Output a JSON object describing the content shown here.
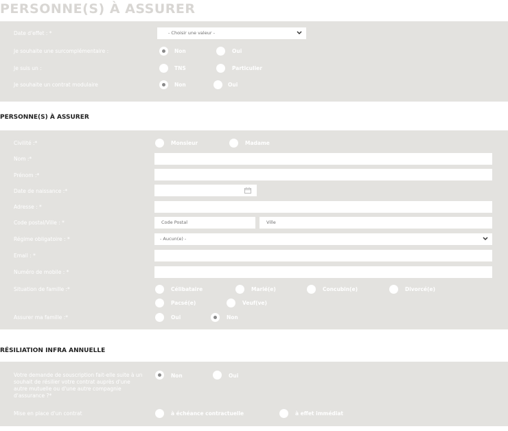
{
  "header": {
    "title": "PERSONNE(S) À ASSURER"
  },
  "section_top": {
    "date_effet": {
      "label": "Date d'effet : *",
      "placeholder": "- Choisir une valeur -"
    },
    "surcomplementaire": {
      "label": "Je souhaite une surcomplémentaire :",
      "options": [
        "Non",
        "Oui"
      ],
      "selected": "Non"
    },
    "je_suis": {
      "label": "Je suis un :",
      "options": [
        "TNS",
        "Particulier"
      ],
      "selected": ""
    },
    "modulaire": {
      "label": "Je souhaite un contrat modulaire",
      "options": [
        "Non",
        "Oui"
      ],
      "selected": "Non"
    }
  },
  "section_persons": {
    "title": "PERSONNE(S) À ASSURER",
    "civilite": {
      "label": "Civilité :*",
      "options": [
        "Monsieur",
        "Madame"
      ]
    },
    "nom": {
      "label": "Nom :*",
      "value": ""
    },
    "prenom": {
      "label": "Prénom :*",
      "value": ""
    },
    "naissance": {
      "label": "Date de naissance :*",
      "value": ""
    },
    "adresse": {
      "label": "Adresse : *",
      "value": ""
    },
    "code_postal_ville": {
      "label": "Code postal/Ville : *",
      "cp_placeholder": "Code Postal",
      "ville_placeholder": "Ville"
    },
    "regime": {
      "label": "Régime obligatoire : *",
      "value": "- Aucun(e) -"
    },
    "email": {
      "label": "Email : *",
      "value": ""
    },
    "mobile": {
      "label": "Numéro de mobile : *",
      "value": ""
    },
    "situation": {
      "label": "Situation de famille :*",
      "options": [
        "Célibataire",
        "Marié(e)",
        "Concubin(e)",
        "Divorcé(e)",
        "Pacsé(e)",
        "Veuf(ve)"
      ]
    },
    "assurer_famille": {
      "label": "Assurer ma famille :*",
      "options": [
        "Oui",
        "Non"
      ],
      "selected": "Non"
    }
  },
  "section_resiliation": {
    "title": "RÉSILIATION INFRA ANNUELLE",
    "demande": {
      "label": "Votre demande de souscription fait-elle suite à un souhait de résilier votre contrat auprès d'une autre mutuelle ou d'une autre compagnie d'assurance ?*",
      "options": [
        "Non",
        "Oui"
      ],
      "selected": "Non"
    },
    "mise_en_place": {
      "label": "Mise en place d'un contrat",
      "options": [
        "à échéance contractuelle",
        "à effet immédiat"
      ]
    }
  }
}
